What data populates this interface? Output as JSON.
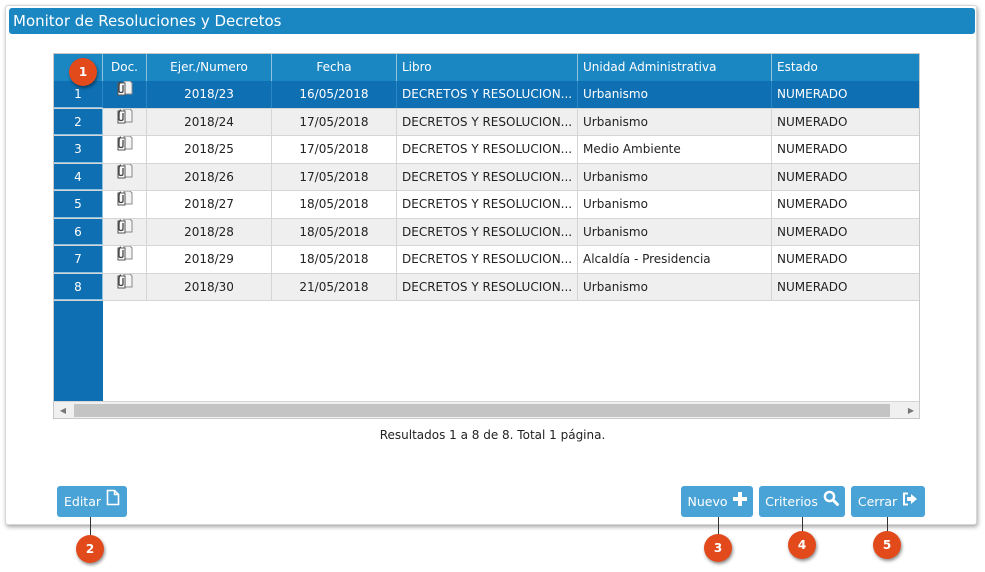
{
  "window": {
    "title": "Monitor de Resoluciones y Decretos"
  },
  "table": {
    "columns": [
      "Doc.",
      "Ejer./Numero",
      "Fecha",
      "Libro",
      "Unidad Administrativa",
      "Estado"
    ],
    "rows": [
      {
        "n": "1",
        "ejer": "2018/23",
        "fecha": "16/05/2018",
        "libro": "DECRETOS Y RESOLUCION...",
        "unidad": "Urbanismo",
        "estado": "NUMERADO"
      },
      {
        "n": "2",
        "ejer": "2018/24",
        "fecha": "17/05/2018",
        "libro": "DECRETOS Y RESOLUCION...",
        "unidad": "Urbanismo",
        "estado": "NUMERADO"
      },
      {
        "n": "3",
        "ejer": "2018/25",
        "fecha": "17/05/2018",
        "libro": "DECRETOS Y RESOLUCION...",
        "unidad": "Medio Ambiente",
        "estado": "NUMERADO"
      },
      {
        "n": "4",
        "ejer": "2018/26",
        "fecha": "17/05/2018",
        "libro": "DECRETOS Y RESOLUCION...",
        "unidad": "Urbanismo",
        "estado": "NUMERADO"
      },
      {
        "n": "5",
        "ejer": "2018/27",
        "fecha": "18/05/2018",
        "libro": "DECRETOS Y RESOLUCION...",
        "unidad": "Urbanismo",
        "estado": "NUMERADO"
      },
      {
        "n": "6",
        "ejer": "2018/28",
        "fecha": "18/05/2018",
        "libro": "DECRETOS Y RESOLUCION...",
        "unidad": "Urbanismo",
        "estado": "NUMERADO"
      },
      {
        "n": "7",
        "ejer": "2018/29",
        "fecha": "18/05/2018",
        "libro": "DECRETOS Y RESOLUCION...",
        "unidad": "Alcaldía - Presidencia",
        "estado": "NUMERADO"
      },
      {
        "n": "8",
        "ejer": "2018/30",
        "fecha": "21/05/2018",
        "libro": "DECRETOS Y RESOLUCION...",
        "unidad": "Urbanismo",
        "estado": "NUMERADO"
      }
    ],
    "selected_row": 0,
    "doc_icon": "attachment-document-icon"
  },
  "results_text": "Resultados 1 a 8 de 8. Total 1 página.",
  "buttons": {
    "editar": "Editar",
    "nuevo": "Nuevo",
    "criterios": "Criterios",
    "cerrar": "Cerrar"
  },
  "badges": [
    "1",
    "2",
    "3",
    "4",
    "5"
  ],
  "colors": {
    "title_bar": "#1a86c2",
    "row_number_column": "#0e6fb3",
    "button": "#4aa3d6",
    "badge": "#e24a1b"
  }
}
